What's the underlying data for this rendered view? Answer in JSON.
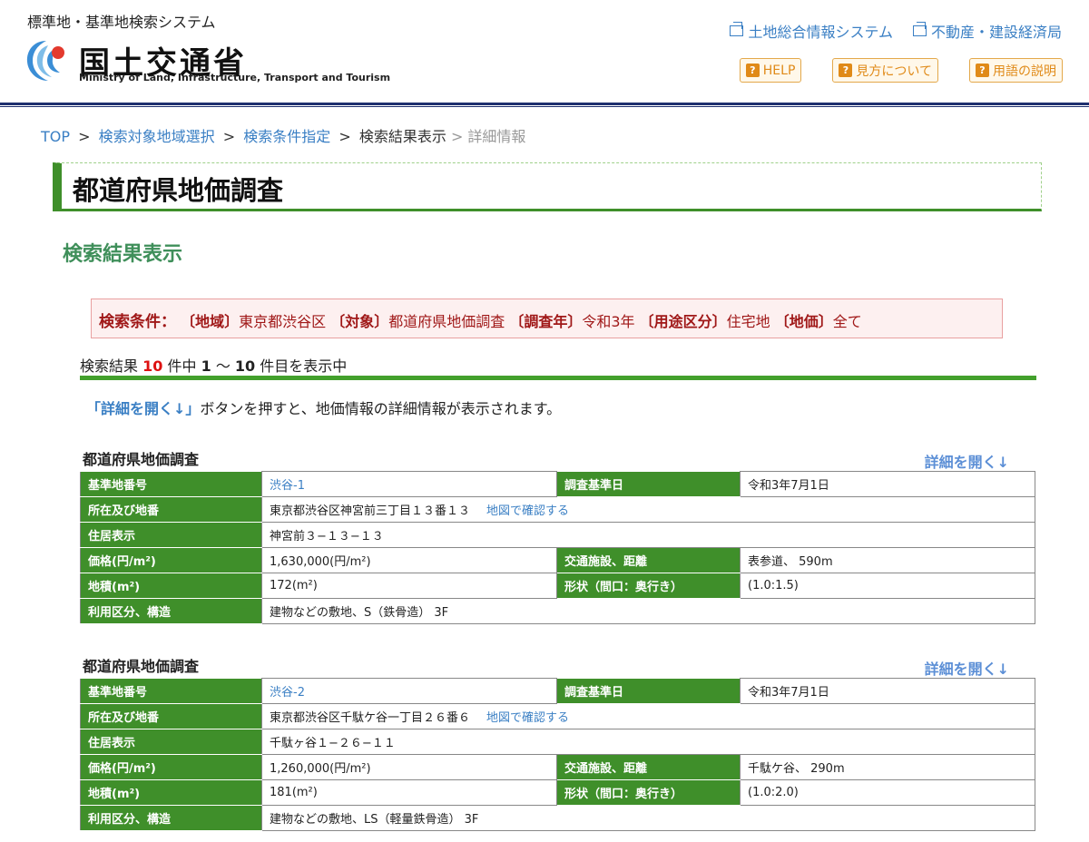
{
  "header": {
    "system_name": "標準地・基準地検索システム",
    "ministry_ja": "国土交通省",
    "ministry_en": "Ministry of Land, Infrastructure, Transport and Tourism",
    "ext_links": [
      "土地総合情報システム",
      "不動産・建設経済局"
    ],
    "help_buttons": [
      "HELP",
      "見方について",
      "用語の説明"
    ]
  },
  "breadcrumb": {
    "top": "TOP",
    "area_select": "検索対象地域選択",
    "condition": "検索条件指定",
    "current": "検索結果表示",
    "detail": "> 詳細情報",
    "sep": ">"
  },
  "page_title": "都道府県地価調査",
  "section_title": "検索結果表示",
  "search_conditions": {
    "label": "検索条件：",
    "items": [
      {
        "key": "〔地域〕",
        "value": "東京都渋谷区"
      },
      {
        "key": "〔対象〕",
        "value": "都道府県地価調査"
      },
      {
        "key": "〔調査年〕",
        "value": "令和3年"
      },
      {
        "key": "〔用途区分〕",
        "value": "住宅地"
      },
      {
        "key": "〔地価〕",
        "value": "全て"
      }
    ]
  },
  "result": {
    "prefix": "検索結果",
    "total": "10",
    "mid": "件中",
    "from": "1",
    "tilde": "〜",
    "to": "10",
    "suffix": "件目を表示中"
  },
  "note": {
    "highlight": "「詳細を開く↓」",
    "text": "ボタンを押すと、地価情報の詳細情報が表示されます。"
  },
  "labels": {
    "record_title": "都道府県地価調査",
    "open_detail": "詳細を開く↓",
    "std_no": "基準地番号",
    "survey_date": "調査基準日",
    "location": "所在及び地番",
    "map_link": "地図で確認する",
    "address": "住居表示",
    "price": "価格(円/m²)",
    "transport": "交通施設、距離",
    "area": "地積(m²)",
    "shape": "形状（間口：奥行き）",
    "usage": "利用区分、構造"
  },
  "records": [
    {
      "std_no": "渋谷-1",
      "survey_date": "令和3年7月1日",
      "location": "東京都渋谷区神宮前三丁目１３番１３",
      "address": "神宮前３−１３−１３",
      "price": "1,630,000(円/m²)",
      "transport": "表参道、 590m",
      "area": "172(m²)",
      "shape": "(1.0:1.5)",
      "usage": "建物などの敷地、S（鉄骨造） 3F"
    },
    {
      "std_no": "渋谷-2",
      "survey_date": "令和3年7月1日",
      "location": "東京都渋谷区千駄ケ谷一丁目２６番６",
      "address": "千駄ヶ谷１−２６−１１",
      "price": "1,260,000(円/m²)",
      "transport": "千駄ケ谷、 290m",
      "area": "181(m²)",
      "shape": "(1.0:2.0)",
      "usage": "建物などの敷地、LS（軽量鉄骨造） 3F"
    }
  ]
}
